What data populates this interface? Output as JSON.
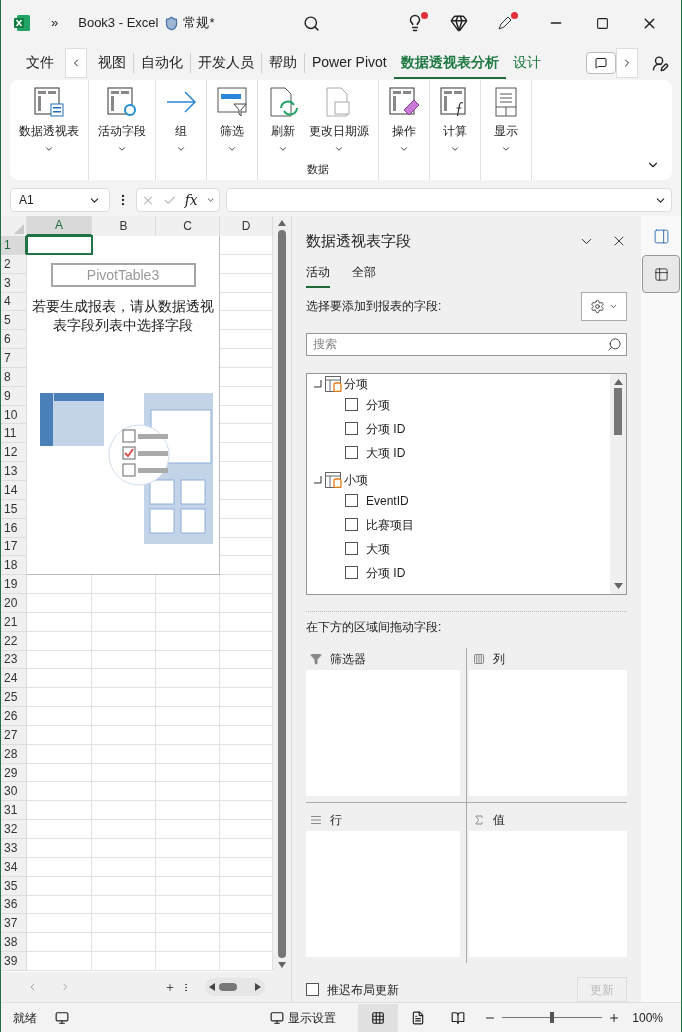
{
  "title_bar": {
    "overflow": "»",
    "title": "Book3 - Excel",
    "label": "常规*"
  },
  "ribbon_tabs": [
    {
      "label": "文件",
      "selected": false,
      "contextual": false
    },
    {
      "label": "视图",
      "selected": false,
      "contextual": false
    },
    {
      "label": "自动化",
      "selected": false,
      "contextual": false
    },
    {
      "label": "开发人员",
      "selected": false,
      "contextual": false
    },
    {
      "label": "帮助",
      "selected": false,
      "contextual": false
    },
    {
      "label": "Power Pivot",
      "selected": false,
      "contextual": false
    },
    {
      "label": "数据透视表分析",
      "selected": true,
      "contextual": true
    },
    {
      "label": "设计",
      "selected": false,
      "contextual": true
    }
  ],
  "ribbon_groups": [
    {
      "items": [
        "数据透视表"
      ]
    },
    {
      "items": [
        "活动字段"
      ]
    },
    {
      "items": [
        "组"
      ]
    },
    {
      "items": [
        "筛选"
      ]
    },
    {
      "label": "数据",
      "items": [
        "刷新",
        "更改日期源"
      ]
    },
    {
      "items": [
        "操作"
      ]
    },
    {
      "items": [
        "计算"
      ]
    },
    {
      "items": [
        "显示"
      ]
    }
  ],
  "formula_bar": {
    "name_box": "A1",
    "fx": "fx"
  },
  "sheet": {
    "columns": [
      {
        "label": "A",
        "selected": true
      },
      {
        "label": "B",
        "selected": false
      },
      {
        "label": "C",
        "selected": false
      },
      {
        "label": "D",
        "selected": false
      }
    ],
    "rows": [
      {
        "label": "1",
        "selected": true
      },
      {
        "label": "2",
        "selected": false
      },
      {
        "label": "3",
        "selected": false
      },
      {
        "label": "4",
        "selected": false
      },
      {
        "label": "5",
        "selected": false
      },
      {
        "label": "6",
        "selected": false
      },
      {
        "label": "7",
        "selected": false
      },
      {
        "label": "8",
        "selected": false
      },
      {
        "label": "9",
        "selected": false
      },
      {
        "label": "10",
        "selected": false
      },
      {
        "label": "11",
        "selected": false
      },
      {
        "label": "12",
        "selected": false
      },
      {
        "label": "13",
        "selected": false
      },
      {
        "label": "14",
        "selected": false
      },
      {
        "label": "15",
        "selected": false
      },
      {
        "label": "16",
        "selected": false
      },
      {
        "label": "17",
        "selected": false
      },
      {
        "label": "18",
        "selected": false
      },
      {
        "label": "19",
        "selected": false
      },
      {
        "label": "20",
        "selected": false
      },
      {
        "label": "21",
        "selected": false
      },
      {
        "label": "22",
        "selected": false
      },
      {
        "label": "23",
        "selected": false
      },
      {
        "label": "24",
        "selected": false
      },
      {
        "label": "25",
        "selected": false
      },
      {
        "label": "26",
        "selected": false
      },
      {
        "label": "27",
        "selected": false
      },
      {
        "label": "28",
        "selected": false
      },
      {
        "label": "29",
        "selected": false
      },
      {
        "label": "30",
        "selected": false
      },
      {
        "label": "31",
        "selected": false
      },
      {
        "label": "32",
        "selected": false
      },
      {
        "label": "33",
        "selected": false
      },
      {
        "label": "34",
        "selected": false
      },
      {
        "label": "35",
        "selected": false
      },
      {
        "label": "36",
        "selected": false
      },
      {
        "label": "37",
        "selected": false
      },
      {
        "label": "38",
        "selected": false
      },
      {
        "label": "39",
        "selected": false
      }
    ],
    "pivot_placeholder": {
      "name": "PivotTable3",
      "message": "若要生成报表，请从数据透视表字段列表中选择字段"
    }
  },
  "pivot_pane": {
    "title": "数据透视表字段",
    "tabs": [
      {
        "label": "活动",
        "selected": true
      },
      {
        "label": "全部",
        "selected": false
      }
    ],
    "choose_label": "选择要添加到报表的字段:",
    "search": {
      "placeholder": "搜索"
    },
    "fields": [
      {
        "label": "分项",
        "expanded": true,
        "children": [
          {
            "label": "分项",
            "checked": false
          },
          {
            "label": "分项 ID",
            "checked": false
          },
          {
            "label": "大项 ID",
            "checked": false
          }
        ]
      },
      {
        "label": "小项",
        "expanded": true,
        "children": [
          {
            "label": "EventID",
            "checked": false
          },
          {
            "label": "比赛项目",
            "checked": false
          },
          {
            "label": "大项",
            "checked": false
          },
          {
            "label": "分项 ID",
            "checked": false
          }
        ]
      }
    ],
    "drag_label": "在下方的区域间拖动字段:",
    "areas": [
      {
        "label": "筛选器"
      },
      {
        "label": "列"
      },
      {
        "label": "行"
      },
      {
        "label": "值"
      }
    ],
    "defer_update": {
      "label": "推迟布局更新",
      "checked": false
    },
    "update_button": {
      "label": "更新",
      "disabled": true
    }
  },
  "status_bar": {
    "status": "就绪",
    "display_settings": "显示设置",
    "views": [
      {
        "selected": true
      },
      {
        "selected": false
      },
      {
        "selected": false
      }
    ],
    "zoom": {
      "level": 0.5,
      "reading": "100%"
    }
  }
}
